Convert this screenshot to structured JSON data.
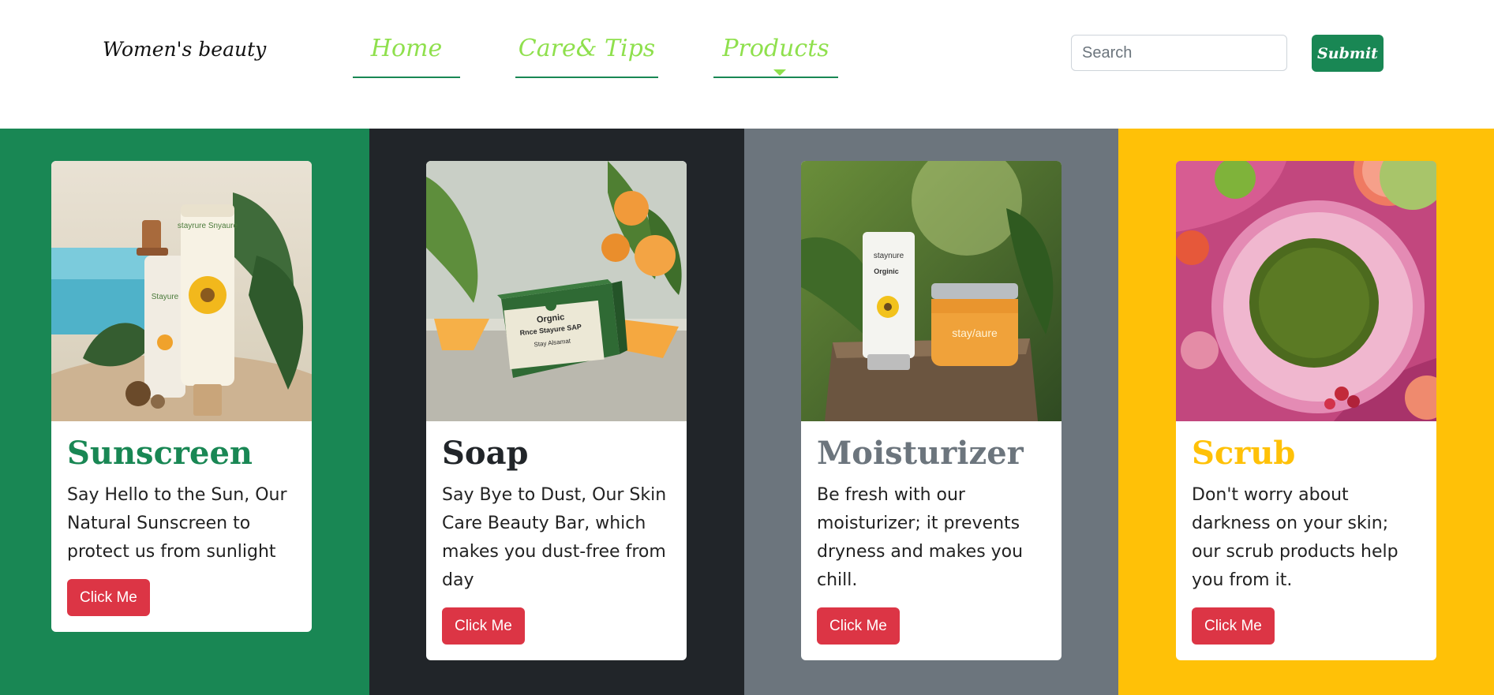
{
  "navbar": {
    "brand": "Women's beauty",
    "links": [
      {
        "label": "Home"
      },
      {
        "label": "Care& Tips"
      },
      {
        "label": "Products",
        "icon": "caret-down-icon"
      }
    ],
    "search": {
      "placeholder": "Search",
      "value": ""
    },
    "submit_label": "Submit",
    "colors": {
      "link": "#8fe04d",
      "underline": "#198754",
      "submit_bg": "#198754"
    }
  },
  "panels": [
    {
      "background": "#198754",
      "card": {
        "image": "sunscreen-product-photo",
        "title": "Sunscreen",
        "title_color": "#198754",
        "text": "Say Hello to the Sun, Our Natural Sunscreen to protect us from sunlight",
        "button": "Click Me"
      }
    },
    {
      "background": "#212529",
      "card": {
        "image": "soap-product-photo",
        "title": "Soap",
        "title_color": "#212529",
        "text": "Say Bye to Dust, Our Skin Care Beauty Bar, which makes you dust-free from day",
        "button": "Click Me",
        "image_text": {
          "line1": "Orgnic",
          "line2": "Rnce Stayure SAP",
          "line3": "Stay Alsamat"
        }
      }
    },
    {
      "background": "#6c757d",
      "card": {
        "image": "moisturizer-product-photo",
        "title": "Moisturizer",
        "title_color": "#6c757d",
        "text": "Be fresh with our moisturizer; it prevents dryness and makes you chill.",
        "button": "Click Me",
        "image_text": {
          "tube_brand": "staynure",
          "tube_name": "Orginic",
          "jar_brand": "stay/aure"
        }
      }
    },
    {
      "background": "#ffc107",
      "card": {
        "image": "scrub-product-photo",
        "title": "Scrub",
        "title_color": "#ffc107",
        "text": "Don't worry about darkness on your skin; our scrub products help you from it.",
        "button": "Click Me"
      }
    }
  ],
  "image_text": {
    "sunscreen_bottle": "Stayure",
    "sunscreen_tube": "stayrure Snyaure"
  },
  "button_color": "#dc3545"
}
